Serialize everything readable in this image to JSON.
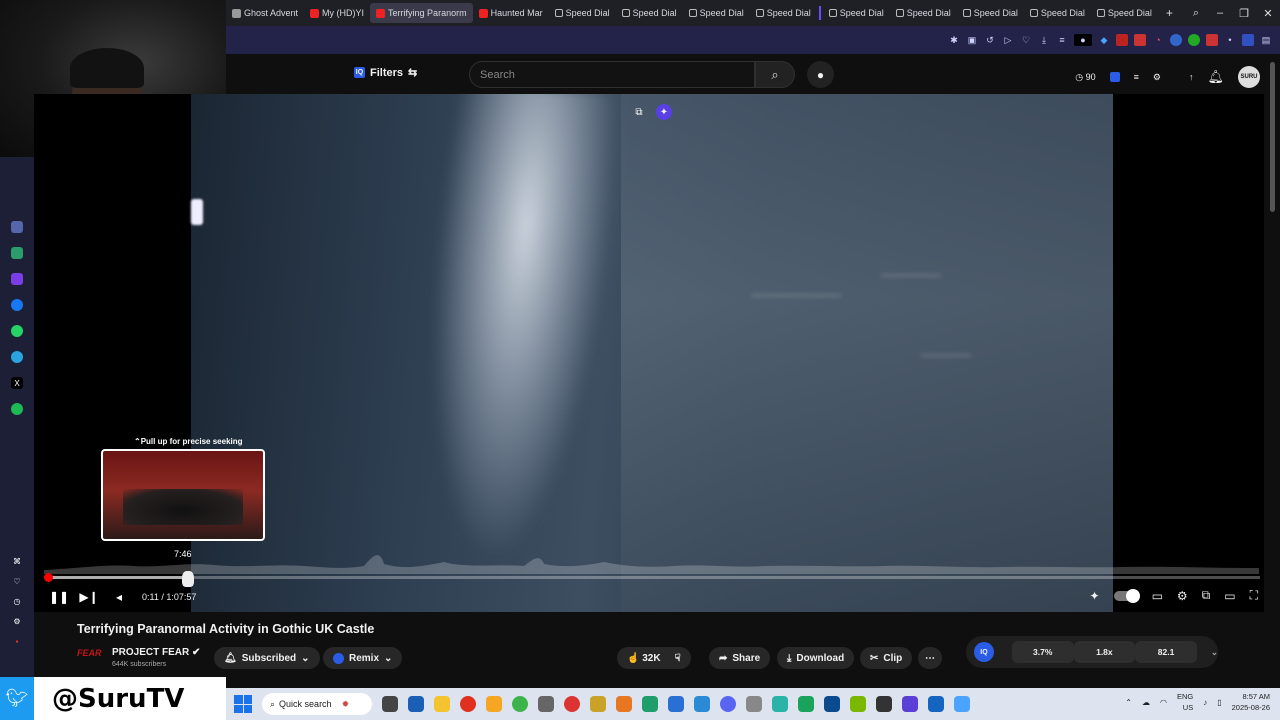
{
  "browser": {
    "tabs": [
      {
        "label": "Ghost Advent",
        "active": false,
        "favicon": "ghost-icon"
      },
      {
        "label": "My (HD)YI",
        "active": false,
        "favicon": "youtube-icon"
      },
      {
        "label": "Terrifying Paranorm",
        "active": true,
        "favicon": "youtube-icon"
      },
      {
        "label": "Haunted Mar",
        "active": false,
        "favicon": "youtube-icon"
      },
      {
        "label": "Speed Dial",
        "active": false,
        "favicon": "speed-dial-icon"
      },
      {
        "label": "Speed Dial",
        "active": false,
        "favicon": "speed-dial-icon"
      },
      {
        "label": "Speed Dial",
        "active": false,
        "favicon": "speed-dial-icon"
      },
      {
        "label": "Speed Dial",
        "active": false,
        "favicon": "speed-dial-icon"
      },
      {
        "label": "Speed Dial",
        "active": false,
        "favicon": "speed-dial-icon"
      },
      {
        "label": "Speed Dial",
        "active": false,
        "favicon": "speed-dial-icon"
      },
      {
        "label": "Speed Dial",
        "active": false,
        "favicon": "speed-dial-icon"
      },
      {
        "label": "Speed Dial",
        "active": false,
        "favicon": "speed-dial-icon"
      },
      {
        "label": "Speed Dial",
        "active": false,
        "favicon": "speed-dial-icon"
      }
    ],
    "new_tab": "+"
  },
  "youtube_header": {
    "filters_label": "Filters",
    "search_placeholder": "Search",
    "ad_counter": "90"
  },
  "player": {
    "seek_hint": "Pull up for precise seeking",
    "hover_time": "7:46",
    "current_time": "0:11",
    "duration": "1:07:57",
    "progress_fraction": 0.0027,
    "buffer_fraction": 0.114
  },
  "video": {
    "title": "Terrifying Paranormal Activity in Gothic UK Castle",
    "channel_name": "PROJECT FEAR",
    "channel_logo_text": "FEAR",
    "subscribers": "644K subscribers",
    "subscribed_label": "Subscribed",
    "remix_label": "Remix",
    "likes": "32K",
    "share_label": "Share",
    "download_label": "Download",
    "clip_label": "Clip"
  },
  "stats": {
    "badge": "IQ",
    "values": [
      "3.7%",
      "1.8x",
      "82.1"
    ]
  },
  "overlay": {
    "twitter_handle": "@SuruTV"
  },
  "taskbar": {
    "search_placeholder": "Quick search",
    "lang_top": "ENG",
    "lang_bottom": "US",
    "time": "8:57 AM",
    "date": "2025-08-26"
  },
  "colors": {
    "accent_red": "#ff0000",
    "youtube_bg": "#0f0f0f",
    "iq_blue": "#2b5ce6"
  }
}
